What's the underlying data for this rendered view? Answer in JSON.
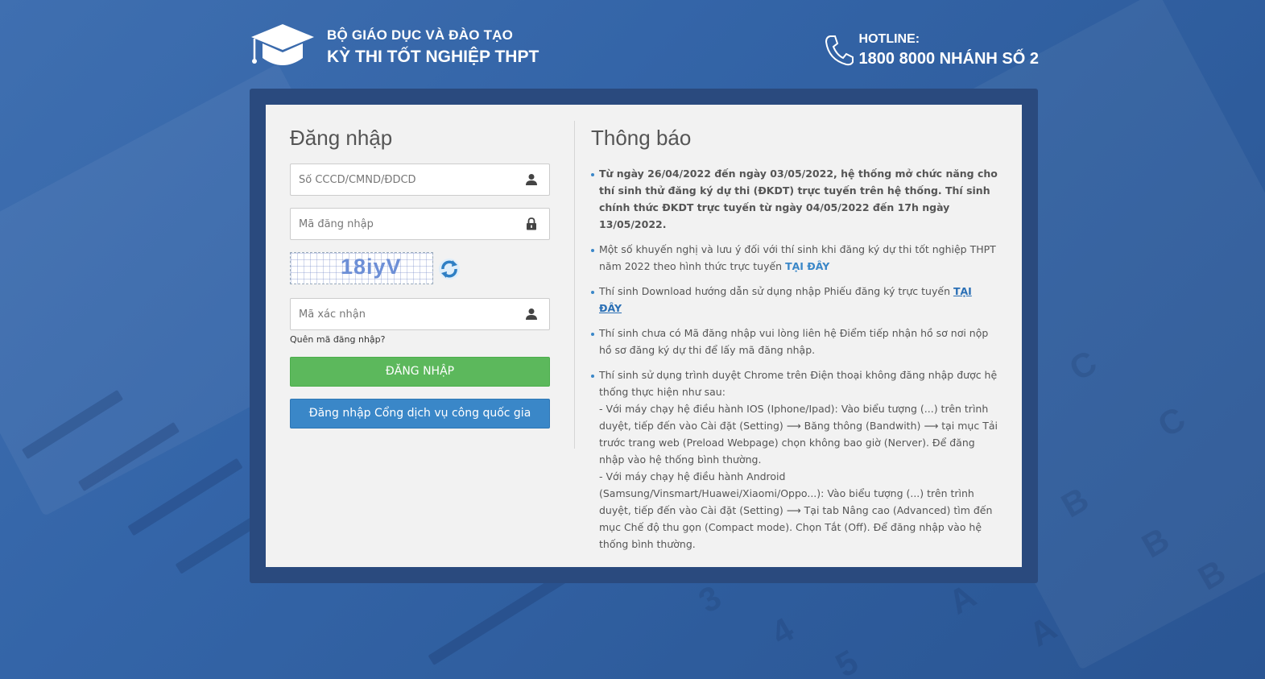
{
  "header": {
    "ministry": "BỘ GIÁO DỤC VÀ ĐÀO TẠO",
    "exam": "KỲ THI TỐT NGHIỆP THPT",
    "hotline_label": "HOTLINE:",
    "hotline_number": "1800 8000 NHÁNH SỐ 2"
  },
  "login": {
    "title": "Đăng nhập",
    "id_placeholder": "Số CCCD/CMND/ĐDCD",
    "code_placeholder": "Mã đăng nhập",
    "captcha_text": "18iyV",
    "verify_placeholder": "Mã xác nhận",
    "forgot": "Quên mã đăng nhập?",
    "submit": "ĐĂNG NHẬP",
    "national_portal": "Đăng nhập Cổng dịch vụ công quốc gia"
  },
  "notice": {
    "title": "Thông báo",
    "item1": "Từ ngày 26/04/2022 đến ngày 03/05/2022, hệ thống mở chức năng cho thí sinh thử đăng ký dự thi (ĐKDT) trực tuyến trên hệ thống. Thí sinh chính thức ĐKDT trực tuyến từ ngày 04/05/2022 đến 17h ngày 13/05/2022.",
    "item2": "Một số khuyến nghị và lưu ý đối với thí sinh khi đăng ký dự thi tốt nghiệp THPT năm 2022 theo hình thức trực tuyến ",
    "item2_link": "TẠI ĐÂY",
    "item3": "Thí sinh Download hướng dẫn sử dụng nhập Phiếu đăng ký trực tuyến ",
    "item3_link": "TẠI ĐÂY",
    "item4": "Thí sinh chưa có Mã đăng nhập vui lòng liên hệ Điểm tiếp nhận hồ sơ nơi nộp hồ sơ đăng ký dự thi để lấy mã đăng nhập.",
    "item5": "Thí sinh sử dụng trình duyệt Chrome trên Điện thoại không đăng nhập được hệ thống thực hiện như sau:",
    "item5_ios": "- Với máy chạy hệ điều hành IOS (Iphone/Ipad): Vào biểu tượng (...) trên trình duyệt, tiếp đến vào Cài đặt (Setting) ⟶ Băng thông (Bandwith) ⟶ tại mục Tải trước trang web (Preload Webpage) chọn không bao giờ (Nerver). Để đăng nhập vào hệ thống bình thường.",
    "item5_android": "- Với máy chạy hệ điều hành Android (Samsung/Vinsmart/Huawei/Xiaomi/Oppo...): Vào biểu tượng (...) trên trình duyệt, tiếp đến vào Cài đặt (Setting) ⟶ Tại tab Nâng cao (Advanced) tìm đến mục Chế độ thu gọn (Compact mode). Chọn Tắt (Off). Để đăng nhập vào hệ thống bình thường."
  },
  "icons": {
    "logo": "graduation-cap-icon",
    "phone": "phone-icon",
    "user": "user-icon",
    "lock": "lock-icon",
    "refresh": "refresh-icon"
  },
  "colors": {
    "background": "#3465a8",
    "frame": "#2a4a7e",
    "green_button": "#5cb85c",
    "blue_button": "#3a87c8"
  }
}
